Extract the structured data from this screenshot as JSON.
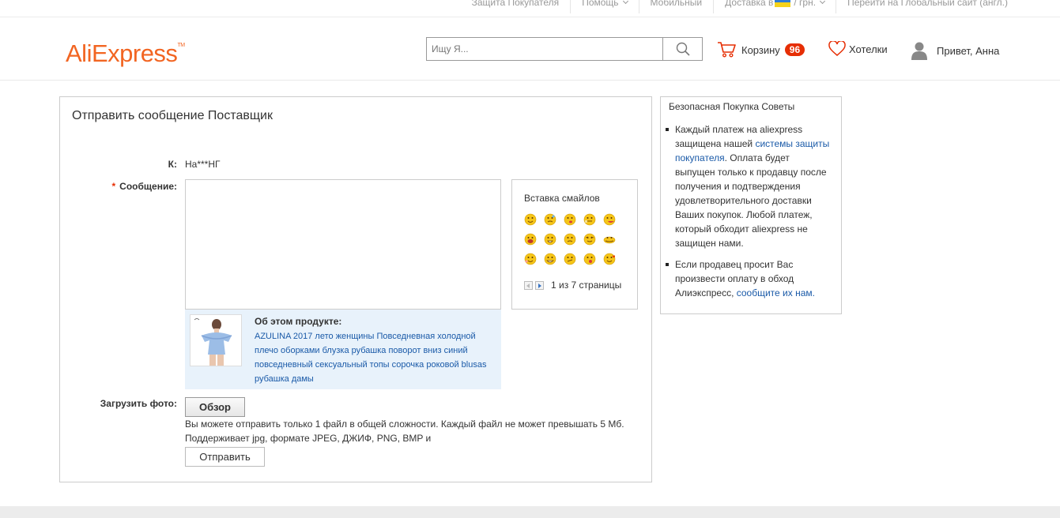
{
  "topbar": {
    "buyer_protection": "Защита Покупателя",
    "help": "Помощь",
    "mobile": "Мобильный",
    "delivery": "Доставка в",
    "currency": "/ грн.",
    "global_site": "Перейти на Глобальный сайт (англ.)"
  },
  "header": {
    "logo": "AliExpress",
    "logo_tm": "TM",
    "search_placeholder": "Ищу Я...",
    "cart_label": "Корзину",
    "cart_count": "96",
    "wishlist_label": "Хотелки",
    "greeting": "Привет, Анна"
  },
  "message": {
    "title": "Отправить сообщение Поставщик",
    "to_label": "К:",
    "to_value": "На***НГ",
    "message_label": "Сообщение:",
    "product_heading": "Об этом продукте:",
    "product_name": "AZULINA 2017 лето женщины Повседневная холодной плечо оборками блузка рубашка поворот вниз синий повседневный сексуальный топы сорочка роковой blusas рубашка дамы",
    "upload_label": "Загрузить фото:",
    "browse_button": "Обзор",
    "upload_note": "Вы можете отправить только 1 файл в общей сложности. Каждый файл не может превышать 5 Мб. Поддерживает jpg, формате JPEG, ДЖИФ, PNG, BMP и",
    "send_button": "Отправить"
  },
  "smileys": {
    "title": "Вставка смайлов",
    "pager_text": "1 из 7 страницы"
  },
  "tips": {
    "title": "Безопасная Покупка Советы",
    "tip1_a": "Каждый платеж на aliexpress защищена нашей ",
    "tip1_link": "системы защиты покупателя",
    "tip1_b": ". Оплата будет выпущен только к продавцу после получения и подтверждения удовлетворительного доставки Ваших покупок. Любой платеж, который обходит aliexpress не защищен нами.",
    "tip2_a": "Если продавец просит Вас произвести оплату в обход Алиэкспресс, ",
    "tip2_link": "сообщите их нам."
  },
  "colors": {
    "brand": "#f26522",
    "badge": "#e62e04",
    "link": "#1a5aa8",
    "product_bg": "#e8f2fb"
  }
}
